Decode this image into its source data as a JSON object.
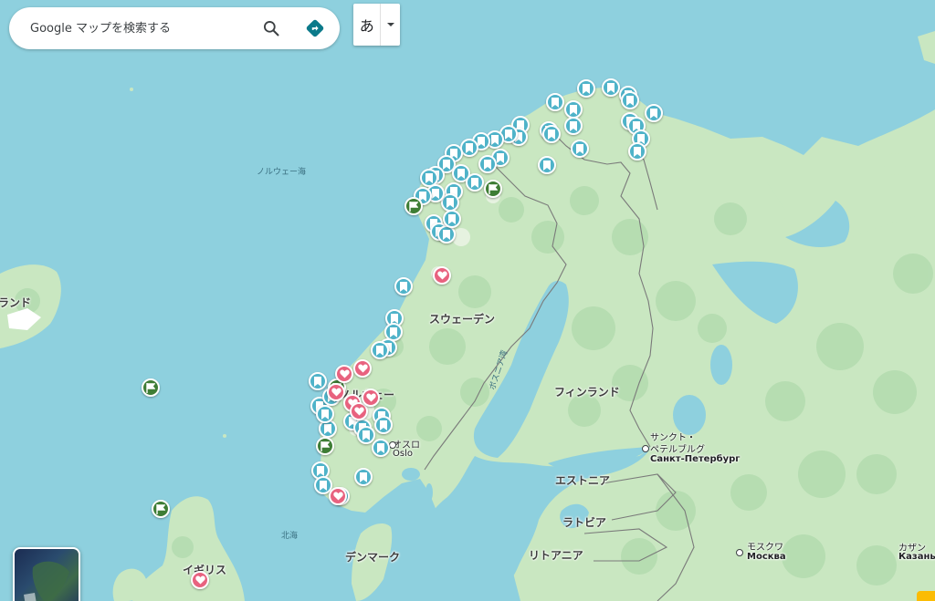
{
  "search": {
    "placeholder": "Google マップを検索する"
  },
  "ime": {
    "char": "あ"
  },
  "labels": {
    "norwegian_sea": "ノルウェー海",
    "north_sea": "北海",
    "iceland_partial": "ランド",
    "sweden": "スウェーデン",
    "finland": "フィンランド",
    "norway": "ノルウェー",
    "gulf_of_bothnia": "ボスニア湾",
    "oslo_ja": "オスロ",
    "oslo_local": "Oslo",
    "spb_ja_1": "サンクト・",
    "spb_ja_2": "ペテルブルグ",
    "spb_local": "Санкт-Петербург",
    "estonia": "エストニア",
    "latvia": "ラトビア",
    "lithuania": "リトアニア",
    "denmark": "デンマーク",
    "uk": "イギリス",
    "moscow_ja": "モスクワ",
    "moscow_local": "Москва",
    "kazan_ja": "カザン",
    "kazan_local": "Казань"
  },
  "colors": {
    "water": "#8ed0de",
    "land": "#c9e7c1",
    "forest": "#b4dcb0",
    "saved_marker": "#4fb3c9",
    "favorite_marker": "#e8627f",
    "flag_marker": "#3e7d35"
  },
  "icons": {
    "search": "search-icon",
    "directions": "directions-icon",
    "dropdown": "dropdown-arrow-icon",
    "saved": "bookmark-icon",
    "favorite": "heart-icon",
    "flag": "flag-icon"
  }
}
